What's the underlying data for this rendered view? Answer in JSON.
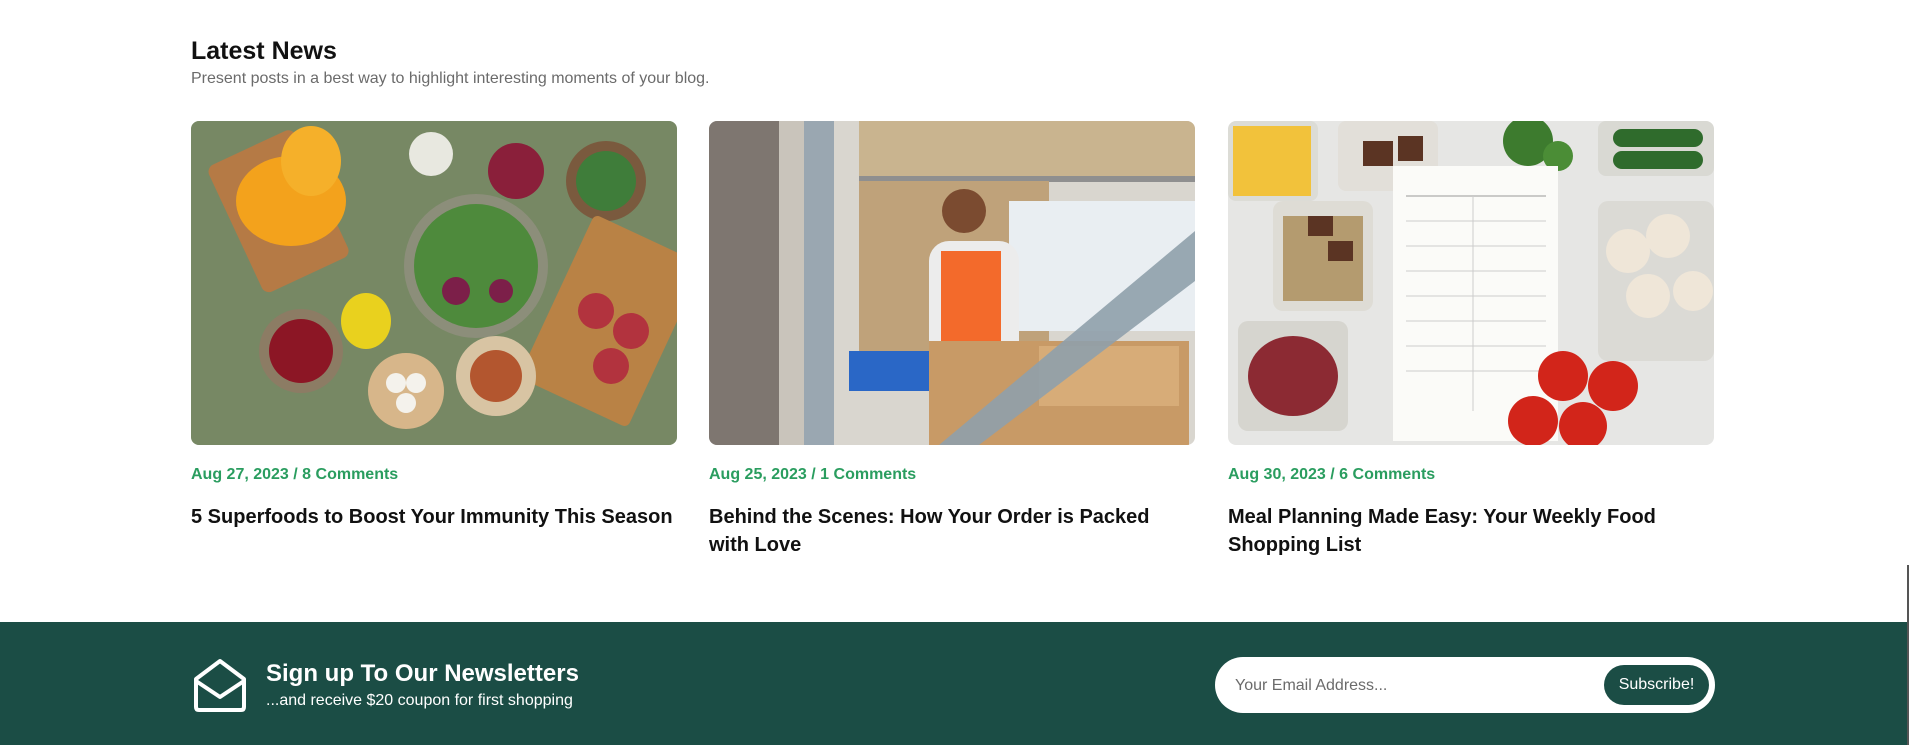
{
  "latest_news": {
    "title": "Latest News",
    "subtitle": "Present posts in a best way to highlight interesting moments of your blog."
  },
  "posts": [
    {
      "meta": "Aug 27, 2023 / 8 Comments",
      "title": "5 Superfoods to Boost Your Immunity This Season",
      "image": "superfoods-bowls-photo"
    },
    {
      "meta": "Aug 25, 2023 / 1 Comments",
      "title": "Behind the Scenes: How Your Order is Packed with Love",
      "image": "warehouse-packing-photo"
    },
    {
      "meta": "Aug 30, 2023 / 6 Comments",
      "title": "Meal Planning Made Easy: Your Weekly Food Shopping List",
      "image": "meal-planner-photo"
    }
  ],
  "newsletter": {
    "title": "Sign up To Our Newsletters",
    "subtitle": "...and receive $20 coupon for first shopping",
    "placeholder": "Your Email Address...",
    "button_label": "Subscribe!",
    "icon": "envelope-open-icon"
  },
  "colors": {
    "accent_green": "#2a9d5f",
    "footer_bg": "#1b4d45"
  }
}
